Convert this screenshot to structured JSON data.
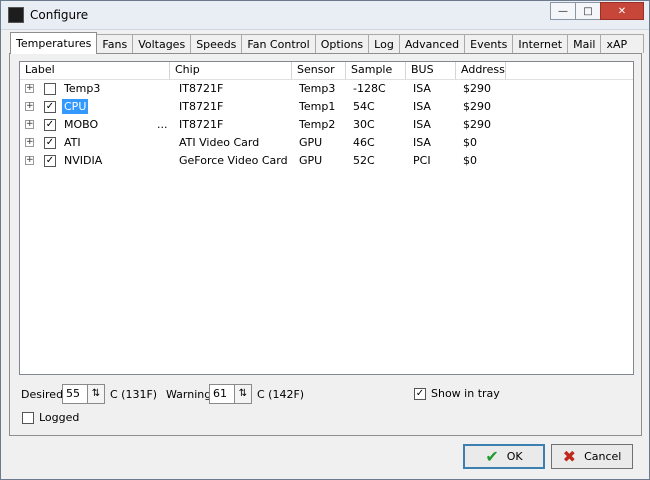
{
  "window": {
    "title": "Configure"
  },
  "tabs": [
    "Temperatures",
    "Fans",
    "Voltages",
    "Speeds",
    "Fan Control",
    "Options",
    "Log",
    "Advanced",
    "Events",
    "Internet",
    "Mail",
    "xAP"
  ],
  "columns": [
    "Label",
    "Chip",
    "Sensor",
    "Sample",
    "BUS",
    "Address"
  ],
  "rows": [
    {
      "checked": false,
      "label": "Temp3",
      "extra": "",
      "chip": "IT8721F",
      "sensor": "Temp3",
      "sample": "-128C",
      "bus": "ISA",
      "address": "$290"
    },
    {
      "checked": true,
      "label": "CPU",
      "extra": "",
      "chip": "IT8721F",
      "sensor": "Temp1",
      "sample": "54C",
      "bus": "ISA",
      "address": "$290"
    },
    {
      "checked": true,
      "label": "MOBO",
      "extra": "...",
      "chip": "IT8721F",
      "sensor": "Temp2",
      "sample": "30C",
      "bus": "ISA",
      "address": "$290"
    },
    {
      "checked": true,
      "label": "ATI",
      "extra": "",
      "chip": "ATI Video Card",
      "sensor": "GPU",
      "sample": "46C",
      "bus": "ISA",
      "address": "$0"
    },
    {
      "checked": true,
      "label": "NVIDIA",
      "extra": "",
      "chip": "GeForce Video Card",
      "sensor": "GPU",
      "sample": "52C",
      "bus": "PCI",
      "address": "$0"
    }
  ],
  "desired": {
    "label": "Desired",
    "value": "55",
    "unit": "C (131F)"
  },
  "warning": {
    "label": "Warning",
    "value": "61",
    "unit": "C (142F)"
  },
  "show_in_tray": {
    "label": "Show in tray",
    "checked": true
  },
  "logged": {
    "label": "Logged",
    "checked": false
  },
  "buttons": {
    "ok": "OK",
    "cancel": "Cancel"
  },
  "colors": {
    "selection": "#3399ff",
    "ok_icon": "#1f9c2a",
    "cancel_icon": "#c0281c"
  }
}
